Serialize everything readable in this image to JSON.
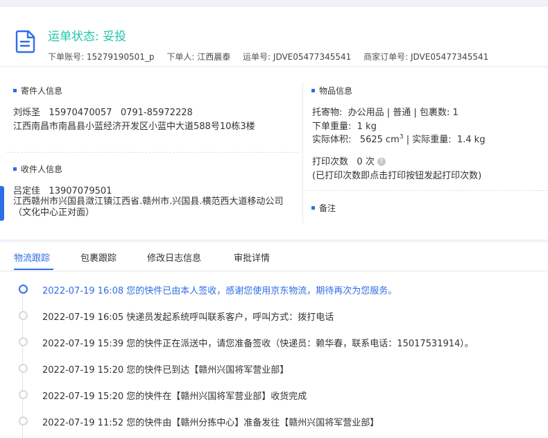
{
  "header": {
    "status_label": "运单状态: ",
    "status_value": "妥投",
    "order_account_label": "下单账号:",
    "order_account_value": "15279190501_p",
    "orderer_label": "下单人:",
    "orderer_value": "江西晨泰",
    "waybill_label": "运单号:",
    "waybill_value": "JDVE05477345541",
    "merchant_order_label": "商家订单号:",
    "merchant_order_value": "JDVE05477345541"
  },
  "sender": {
    "title": "寄件人信息",
    "name": "刘烁圣",
    "phone": "15970470057",
    "tel": "0791-85972228",
    "address": "江西南昌市南昌县小蓝经济开发区小蓝中大道588号10栋3楼"
  },
  "receiver": {
    "title": "收件人信息",
    "name": "吕定佳",
    "phone": "13907079501",
    "address": "江西赣州市兴国县潋江镇江西省.赣州市.兴国县.横范西大道移动公司（文化中心正对面）"
  },
  "goods": {
    "title": "物品信息",
    "consign_label": "托寄物:",
    "consign_value": "办公用品 | 普通 | 包裹数: 1",
    "order_weight_label": "下单重量:",
    "order_weight_value": "1 kg",
    "volume_label": "实际体积:",
    "volume_value": "5625 cm",
    "volume_unit_sup": "3",
    "actual_weight_label": "| 实际重量:",
    "actual_weight_value": "1.4 kg",
    "print_count_label": "打印次数",
    "print_count_value": "0 次",
    "print_hint": "(已打印次数即点击打印按钮发起打印次数)",
    "help_icon_glyph": "?"
  },
  "remark": {
    "title": "备注"
  },
  "tabs": [
    {
      "label": "物流跟踪"
    },
    {
      "label": "包裹跟踪"
    },
    {
      "label": "修改日志信息"
    },
    {
      "label": "审批详情"
    }
  ],
  "timeline": [
    {
      "time": "2022-07-19 16:08",
      "text": "您的快件已由本人签收，感谢您使用京东物流，期待再次为您服务。"
    },
    {
      "time": "2022-07-19 16:05",
      "text": "快递员发起系统呼叫联系客户，呼叫方式：拨打电话"
    },
    {
      "time": "2022-07-19 15:39",
      "text": "您的快件正在派送中，请您准备签收（快递员：赖华春，联系电话：15017531914）。"
    },
    {
      "time": "2022-07-19 15:20",
      "text": "您的快件已到达【赣州兴国将军营业部】"
    },
    {
      "time": "2022-07-19 15:20",
      "text": "您的快件在【赣州兴国将军营业部】收货完成"
    },
    {
      "time": "2022-07-19 11:52",
      "text": "您的快件由【赣州分拣中心】准备发往【赣州兴国将军营业部】"
    }
  ],
  "colors": {
    "accent": "#2e6ee6",
    "status": "#1fc6b0"
  },
  "icons": {
    "header": "document-icon",
    "help": "question-circle-icon"
  }
}
